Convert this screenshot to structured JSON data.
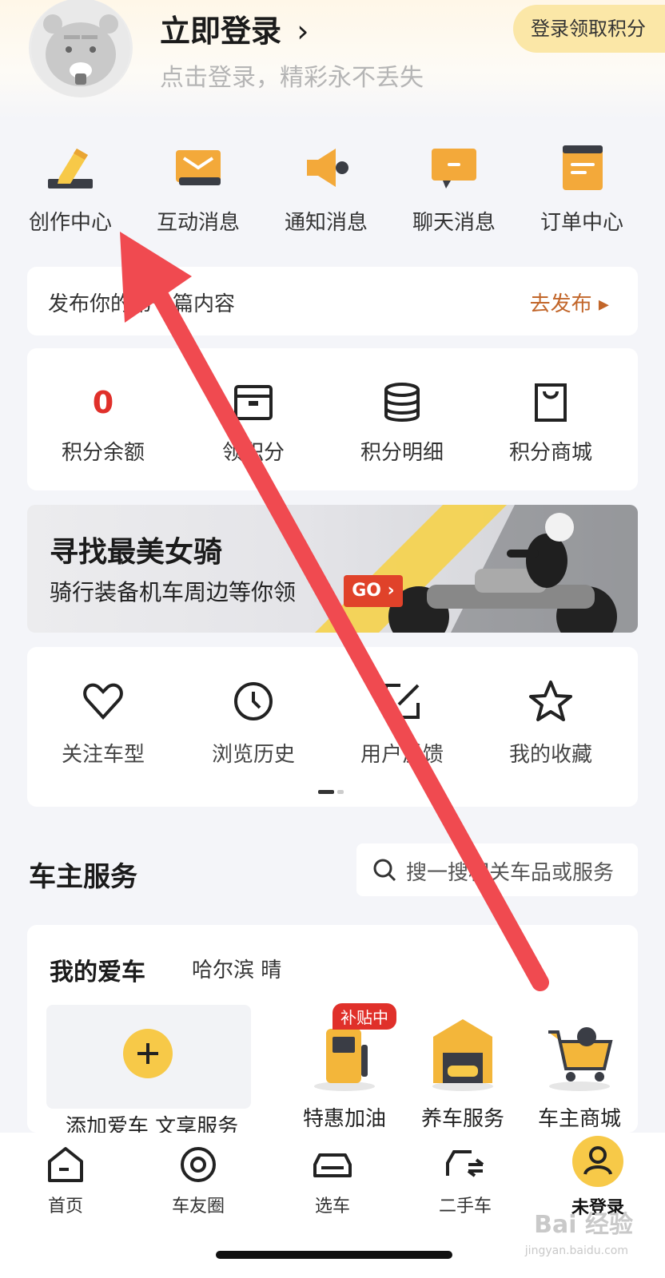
{
  "header": {
    "login_title": "立即登录",
    "login_arrow": "›",
    "login_sub": "点击登录，精彩永不丢失",
    "points_button": "登录领取积分"
  },
  "quick_actions": [
    {
      "label": "创作中心",
      "icon": "pen-icon"
    },
    {
      "label": "互动消息",
      "icon": "envelope-icon"
    },
    {
      "label": "通知消息",
      "icon": "megaphone-icon"
    },
    {
      "label": "聊天消息",
      "icon": "chat-bubble-icon"
    },
    {
      "label": "订单中心",
      "icon": "order-icon"
    }
  ],
  "publish": {
    "text": "发布你的第一篇内容",
    "action": "去发布 ▸"
  },
  "points": [
    {
      "value": "0",
      "label": "积分余额"
    },
    {
      "label": "领积分",
      "icon": "box-icon"
    },
    {
      "label": "积分明细",
      "icon": "database-icon"
    },
    {
      "label": "积分商城",
      "icon": "bag-icon"
    }
  ],
  "banner": {
    "title": "寻找最美女骑",
    "subtitle": "骑行装备机车周边等你领",
    "button": "GO ›"
  },
  "tools": [
    {
      "label": "关注车型",
      "icon": "heart-icon"
    },
    {
      "label": "浏览历史",
      "icon": "clock-icon"
    },
    {
      "label": "用户反馈",
      "icon": "edit-icon"
    },
    {
      "label": "我的收藏",
      "icon": "star-icon"
    }
  ],
  "owner": {
    "section_title": "车主服务",
    "search_placeholder": "搜一搜相关车品或服务",
    "my_car": "我的爱车",
    "city_weather": "哈尔滨  晴",
    "badge": "补贴中",
    "services": [
      {
        "label": "添加爱车 文享服务"
      },
      {
        "label": "特惠加油",
        "icon": "fuel-pump-icon"
      },
      {
        "label": "养车服务",
        "icon": "garage-icon"
      },
      {
        "label": "车主商城",
        "icon": "cart-icon"
      }
    ]
  },
  "tabbar": [
    {
      "label": "首页",
      "icon": "home-icon"
    },
    {
      "label": "车友圈",
      "icon": "circle-icon"
    },
    {
      "label": "选车",
      "icon": "car-icon"
    },
    {
      "label": "二手车",
      "icon": "used-car-icon"
    },
    {
      "label": "未登录",
      "icon": "user-icon",
      "active": true
    }
  ],
  "watermark": {
    "brand": "Bai 经验",
    "url": "jingyan.baidu.com"
  },
  "colors": {
    "accent": "#f7c948",
    "arrow": "#f04a50",
    "price_red": "#e0302a",
    "publish_orange": "#c2662a"
  }
}
